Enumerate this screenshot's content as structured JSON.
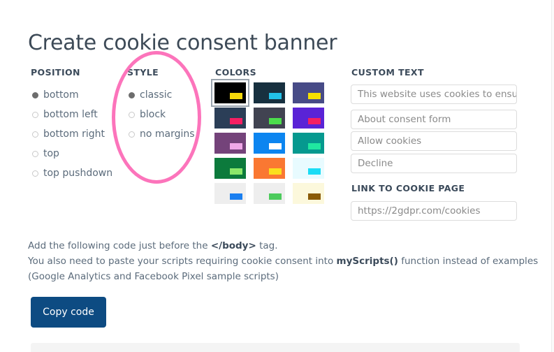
{
  "page": {
    "title": "Create cookie consent banner"
  },
  "position": {
    "heading": "POSITION",
    "options": [
      {
        "label": "bottom",
        "selected": true
      },
      {
        "label": "bottom left",
        "selected": false
      },
      {
        "label": "bottom right",
        "selected": false
      },
      {
        "label": "top",
        "selected": false
      },
      {
        "label": "top pushdown",
        "selected": false
      }
    ]
  },
  "style": {
    "heading": "STYLE",
    "options": [
      {
        "label": "classic",
        "selected": true
      },
      {
        "label": "block",
        "selected": false
      },
      {
        "label": "no margins",
        "selected": false
      }
    ]
  },
  "annotation": {
    "shape": "ellipse-highlight",
    "color": "#fc74bb"
  },
  "colors": {
    "heading": "COLORS",
    "swatches": [
      {
        "name": "black-yellow",
        "bg": "#000000",
        "btn": "#f5d80a",
        "selected": true
      },
      {
        "name": "darkteal-cyan",
        "bg": "#17303f",
        "btn": "#22c1e8",
        "selected": false
      },
      {
        "name": "indigo-yellow",
        "bg": "#474b87",
        "btn": "#f5e000",
        "selected": false
      },
      {
        "name": "navy-pink",
        "bg": "#2b3e57",
        "btn": "#f51f63",
        "selected": false
      },
      {
        "name": "charcoal-green",
        "bg": "#414351",
        "btn": "#4cdd4c",
        "selected": false
      },
      {
        "name": "violet-pink",
        "bg": "#5a23d6",
        "btn": "#f51f63",
        "selected": false
      },
      {
        "name": "purple-lightpink",
        "bg": "#74437a",
        "btn": "#f0a8e8",
        "selected": false
      },
      {
        "name": "blue-white",
        "bg": "#0c85f0",
        "btn": "#ffffff",
        "selected": false
      },
      {
        "name": "teal-springgreen",
        "bg": "#06998f",
        "btn": "#20e8a0",
        "selected": false
      },
      {
        "name": "green-lightgreen",
        "bg": "#0c7a3c",
        "btn": "#8ce86a",
        "selected": false
      },
      {
        "name": "orange-yellow",
        "bg": "#fa7832",
        "btn": "#fbdf1d",
        "selected": false
      },
      {
        "name": "iceblue-cyan",
        "bg": "#e8fbff",
        "btn": "#1adcf5",
        "selected": false
      },
      {
        "name": "white-blue",
        "bg": "#eeeeee",
        "btn": "#1a7ff0",
        "selected": false
      },
      {
        "name": "white-green",
        "bg": "#eeeeee",
        "btn": "#4ccb5c",
        "selected": false
      },
      {
        "name": "cream-brown",
        "bg": "#fcf8dc",
        "btn": "#8a5a06",
        "selected": false
      }
    ]
  },
  "custom_text": {
    "heading": "CUSTOM TEXT",
    "fields": [
      {
        "name": "consent-message",
        "value": "This website uses cookies to ensure"
      },
      {
        "name": "about-link",
        "value": "About consent form"
      },
      {
        "name": "allow-button",
        "value": "Allow cookies"
      },
      {
        "name": "decline-button",
        "value": "Decline"
      }
    ]
  },
  "cookie_link": {
    "heading": "LINK TO COOKIE PAGE",
    "value": "https://2gdpr.com/cookies"
  },
  "instructions": {
    "line1_before": "Add the following code just before the ",
    "line1_code": "</body>",
    "line1_after": " tag.",
    "line2_before": "You also need to paste your scripts requiring cookie consent into ",
    "line2_code": "myScripts()",
    "line2_after": " function instead of examples (Google Analytics and Facebook Pixel sample scripts)"
  },
  "actions": {
    "copy_code_label": "Copy code"
  }
}
